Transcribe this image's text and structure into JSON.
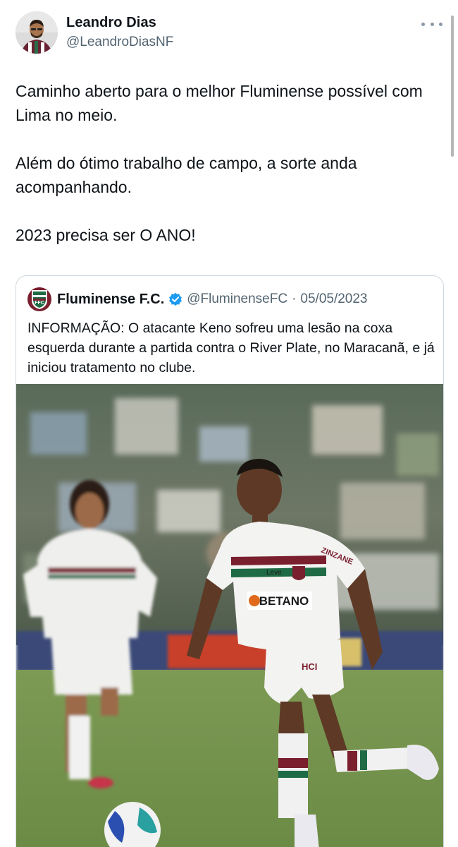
{
  "author": {
    "name": "Leandro Dias",
    "handle": "@LeandroDiasNF"
  },
  "tweet": {
    "paragraphs": [
      "Caminho aberto para o melhor Fluminense possível com Lima no meio.",
      "Além do ótimo trabalho de campo, a sorte anda acompanhando.",
      "2023 precisa ser O ANO!"
    ]
  },
  "quote": {
    "name": "Fluminense F.C.",
    "handle": "@FluminenseFC",
    "separator": "·",
    "date": "05/05/2023",
    "text": "INFORMAÇÃO: O atacante Keno sofreu uma lesão na coxa esquerda durante a partida contra o River Plate, no Maracanã, e já iniciou tratamento no clube.",
    "verified_color": "#1d9bf0"
  },
  "photo": {
    "shirt_sponsor": "BETANO",
    "shirt_brand": "ZINZANE",
    "shirt_sleeve": "Leve",
    "shorts_sponsor": "HCI"
  },
  "colors": {
    "text": "#0f1419",
    "secondary": "#536471",
    "border": "#cfd9de",
    "club_maroon": "#7a1f2e",
    "club_green": "#1f6b45"
  }
}
